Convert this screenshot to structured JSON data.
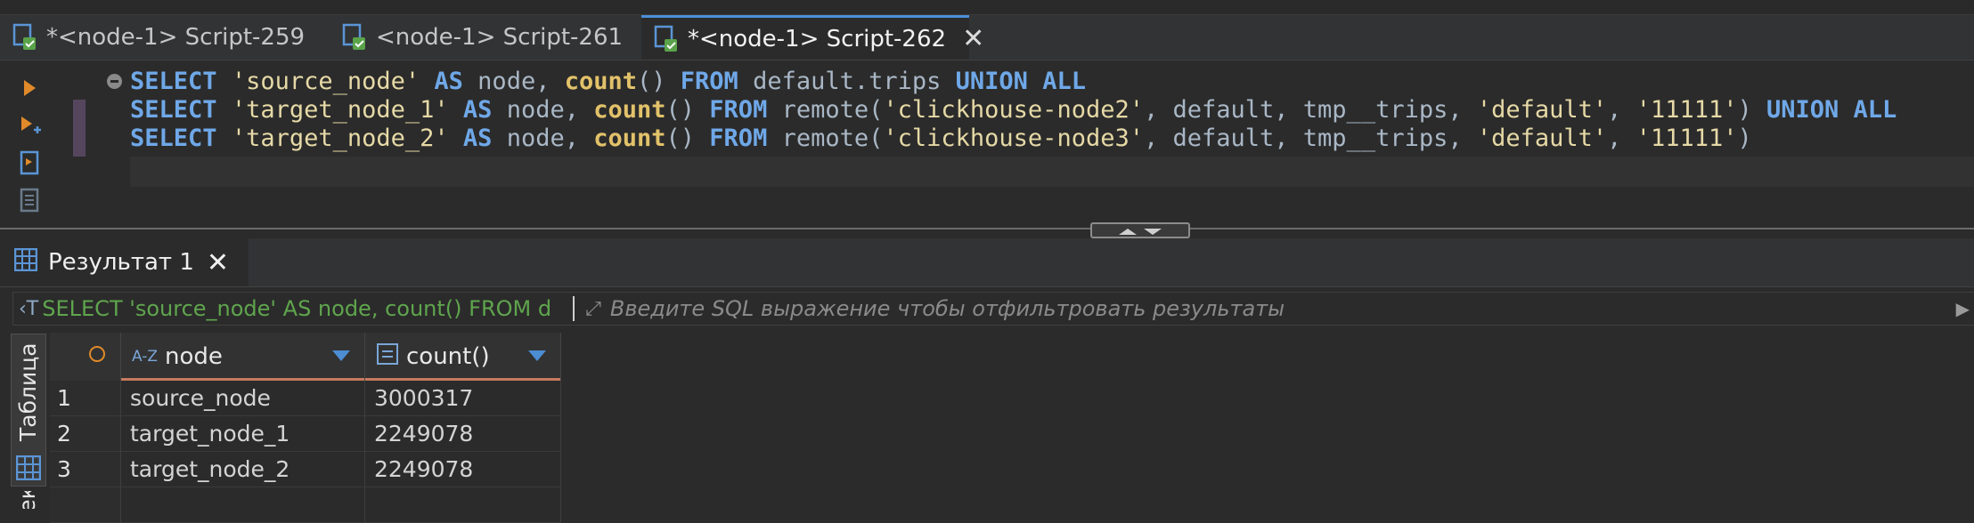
{
  "tabs": [
    {
      "label": "*<node-1> Script-259",
      "active": false
    },
    {
      "label": "<node-1> Script-261",
      "active": false
    },
    {
      "label": "*<node-1> Script-262",
      "active": true
    }
  ],
  "editor": {
    "lines": [
      {
        "tokens": [
          {
            "t": "kw",
            "v": "SELECT"
          },
          {
            "t": "pn",
            "v": " "
          },
          {
            "t": "str",
            "v": "'source_node'"
          },
          {
            "t": "pn",
            "v": " "
          },
          {
            "t": "kw",
            "v": "AS"
          },
          {
            "t": "id",
            "v": " node, "
          },
          {
            "t": "fn",
            "v": "count"
          },
          {
            "t": "pn",
            "v": "() "
          },
          {
            "t": "kw",
            "v": "FROM"
          },
          {
            "t": "id",
            "v": " default.trips "
          },
          {
            "t": "kw",
            "v": "UNION ALL"
          }
        ]
      },
      {
        "tokens": [
          {
            "t": "kw",
            "v": "SELECT"
          },
          {
            "t": "pn",
            "v": " "
          },
          {
            "t": "str",
            "v": "'target_node_1'"
          },
          {
            "t": "pn",
            "v": " "
          },
          {
            "t": "kw",
            "v": "AS"
          },
          {
            "t": "id",
            "v": " node, "
          },
          {
            "t": "fn",
            "v": "count"
          },
          {
            "t": "pn",
            "v": "() "
          },
          {
            "t": "kw",
            "v": "FROM"
          },
          {
            "t": "id",
            "v": " remote("
          },
          {
            "t": "str",
            "v": "'clickhouse-node2'"
          },
          {
            "t": "id",
            "v": ", default, tmp__trips, "
          },
          {
            "t": "str",
            "v": "'default'"
          },
          {
            "t": "id",
            "v": ", "
          },
          {
            "t": "str",
            "v": "'11111'"
          },
          {
            "t": "id",
            "v": ") "
          },
          {
            "t": "kw",
            "v": "UNION ALL"
          }
        ]
      },
      {
        "tokens": [
          {
            "t": "kw",
            "v": "SELECT"
          },
          {
            "t": "pn",
            "v": " "
          },
          {
            "t": "str",
            "v": "'target_node_2'"
          },
          {
            "t": "pn",
            "v": " "
          },
          {
            "t": "kw",
            "v": "AS"
          },
          {
            "t": "id",
            "v": " node, "
          },
          {
            "t": "fn",
            "v": "count"
          },
          {
            "t": "pn",
            "v": "() "
          },
          {
            "t": "kw",
            "v": "FROM"
          },
          {
            "t": "id",
            "v": " remote("
          },
          {
            "t": "str",
            "v": "'clickhouse-node3'"
          },
          {
            "t": "id",
            "v": ", default, tmp__trips, "
          },
          {
            "t": "str",
            "v": "'default'"
          },
          {
            "t": "id",
            "v": ", "
          },
          {
            "t": "str",
            "v": "'11111'"
          },
          {
            "t": "id",
            "v": ")"
          }
        ]
      }
    ]
  },
  "results": {
    "tab_label": "Результат 1",
    "filter": {
      "sql_preview": "SELECT 'source_node' AS node, count() FROM d",
      "placeholder": "Введите SQL выражение чтобы отфильтровать результаты"
    },
    "side_tabs": [
      "Таблица",
      "Текст"
    ],
    "columns": [
      {
        "type_label": "A-Z",
        "name": "node"
      },
      {
        "type_label": "",
        "name": "count()"
      }
    ],
    "rows": [
      {
        "num": "1",
        "node": "source_node",
        "count": "3000317"
      },
      {
        "num": "2",
        "node": "target_node_1",
        "count": "2249078"
      },
      {
        "num": "3",
        "node": "target_node_2",
        "count": "2249078"
      }
    ]
  },
  "colors": {
    "accent": "#4b8fd9",
    "keyword": "#6fa8e8",
    "string": "#e6d9a6",
    "function": "#e2c26a",
    "sql_preview": "#5fa54d"
  },
  "icons": [
    "sql-script-icon",
    "execute-icon",
    "execute-script-icon",
    "explain-icon",
    "grid-icon",
    "close-icon",
    "sort-icon",
    "expand-icon"
  ]
}
